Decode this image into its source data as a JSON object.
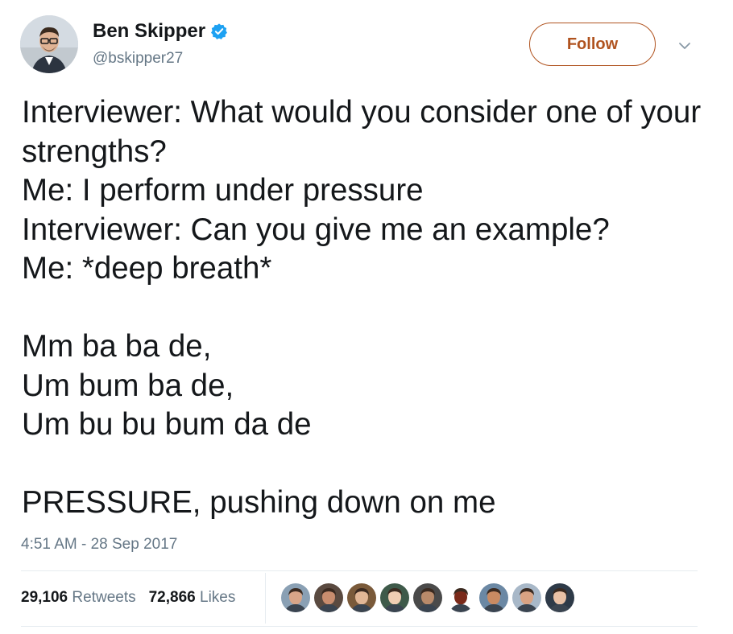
{
  "author": {
    "name": "Ben Skipper",
    "handle": "@bskipper27",
    "verified": true,
    "verified_icon": "verified-badge-icon"
  },
  "follow_label": "Follow",
  "more_icon": "chevron-down-icon",
  "tweet": {
    "lines": [
      "Interviewer: What would you consider one of your strengths?",
      "Me: I perform under pressure",
      "Interviewer: Can you give me an example?",
      "Me: *deep breath*",
      "",
      "Mm ba ba de,",
      "Um bum ba de,",
      "Um bu bu bum da de",
      "",
      "PRESSURE, pushing down on me"
    ]
  },
  "timestamp": "4:51 AM - 28 Sep 2017",
  "stats": {
    "retweets_count": "29,106",
    "retweets_label": "Retweets",
    "likes_count": "72,866",
    "likes_label": "Likes"
  },
  "likers": [
    {
      "name": "liker-1",
      "bg": "#8aa0b4",
      "skin": "#d8a588"
    },
    {
      "name": "liker-2",
      "bg": "#5a4a40",
      "skin": "#c98d6e"
    },
    {
      "name": "liker-3",
      "bg": "#7a5a3a",
      "skin": "#e2b796"
    },
    {
      "name": "liker-4",
      "bg": "#3e5a4a",
      "skin": "#f0cdb3"
    },
    {
      "name": "liker-5",
      "bg": "#4a4a4a",
      "skin": "#b98a6a"
    },
    {
      "name": "liker-6",
      "bg": "#ffffff",
      "skin": "#7a2a1a"
    },
    {
      "name": "liker-7",
      "bg": "#6b88a4",
      "skin": "#c98a62"
    },
    {
      "name": "liker-8",
      "bg": "#a8b8c8",
      "skin": "#d9a383"
    },
    {
      "name": "liker-9",
      "bg": "#2e3a48",
      "skin": "#e9c1a6"
    }
  ],
  "colors": {
    "follow_accent": "#b0531f",
    "verified_blue": "#1da1f2",
    "muted_text": "#657786",
    "primary_text": "#14171a"
  }
}
